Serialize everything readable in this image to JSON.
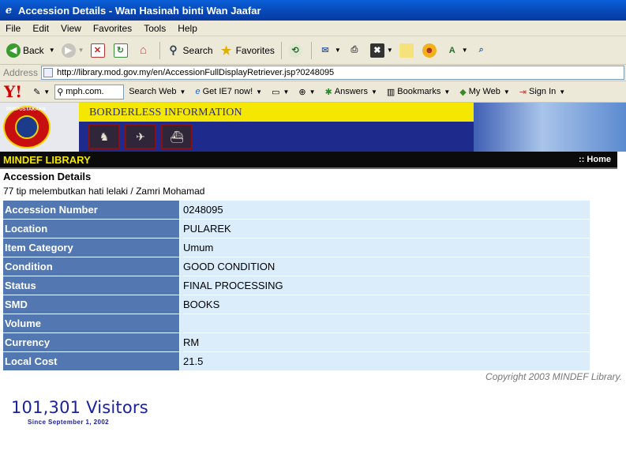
{
  "window": {
    "title": "Accession Details - Wan Hasinah binti Wan Jaafar"
  },
  "menu": [
    "File",
    "Edit",
    "View",
    "Favorites",
    "Tools",
    "Help"
  ],
  "toolbar": {
    "back": "Back",
    "search": "Search",
    "favorites": "Favorites"
  },
  "address": {
    "label": "Address",
    "url": "http://library.mod.gov.my/en/AccessionFullDisplayRetriever.jsp?0248095"
  },
  "yahoo": {
    "logo": "Y!",
    "search_box": "mph.com.",
    "search_web": "Search Web",
    "ie7": "Get IE7 now!",
    "answers": "Answers",
    "bookmarks": "Bookmarks",
    "myweb": "My Web",
    "signin": "Sign In"
  },
  "banner": {
    "title": "BORDERLESS INFORMATION",
    "logo_text": "PERPUSTAKAAN"
  },
  "nav": {
    "library": "MINDEF LIBRARY",
    "home": ":: Home"
  },
  "page": {
    "heading": "Accession Details",
    "subtitle": "77 tip melembutkan hati lelaki / Zamri Mohamad"
  },
  "details": [
    {
      "label": "Accession Number",
      "value": "0248095"
    },
    {
      "label": "Location",
      "value": "PULAREK"
    },
    {
      "label": "Item Category",
      "value": "Umum"
    },
    {
      "label": "Condition",
      "value": "GOOD CONDITION"
    },
    {
      "label": "Status",
      "value": "FINAL PROCESSING"
    },
    {
      "label": "SMD",
      "value": "BOOKS"
    },
    {
      "label": "Volume",
      "value": ""
    },
    {
      "label": "Currency",
      "value": "RM"
    },
    {
      "label": "Local Cost",
      "value": "21.5"
    }
  ],
  "footer": {
    "copyright": "Copyright  2003 MINDEF Library.",
    "visitors": "101,301 Visitors",
    "since": "Since September 1, 2002"
  }
}
